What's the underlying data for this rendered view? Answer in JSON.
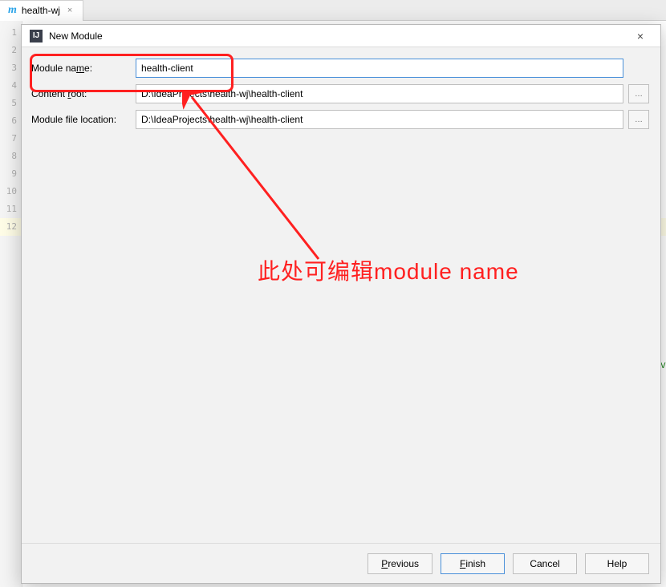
{
  "tab": {
    "label": "health-wj"
  },
  "gutter": [
    "1",
    "2",
    "3",
    "4",
    "5",
    "6",
    "7",
    "8",
    "9",
    "10",
    "11",
    "12"
  ],
  "code": {
    "greenFragment": "av"
  },
  "dialog": {
    "title": "New Module",
    "fields": {
      "moduleName": {
        "label": "Module name:",
        "value": "health-client"
      },
      "contentRoot": {
        "label": "Content root:",
        "value": "D:\\IdeaProjects\\health-wj\\health-client"
      },
      "moduleFileLocation": {
        "label": "Module file location:",
        "value": "D:\\IdeaProjects\\health-wj\\health-client"
      }
    },
    "buttons": {
      "previous": "Previous",
      "finish": "Finish",
      "cancel": "Cancel",
      "help": "Help"
    }
  },
  "annotation": {
    "text": "此处可编辑module name",
    "color": "#ff2020"
  },
  "icons": {
    "mavenM": "m",
    "intellij": "IJ",
    "close": "×",
    "ellipsis": "…"
  }
}
